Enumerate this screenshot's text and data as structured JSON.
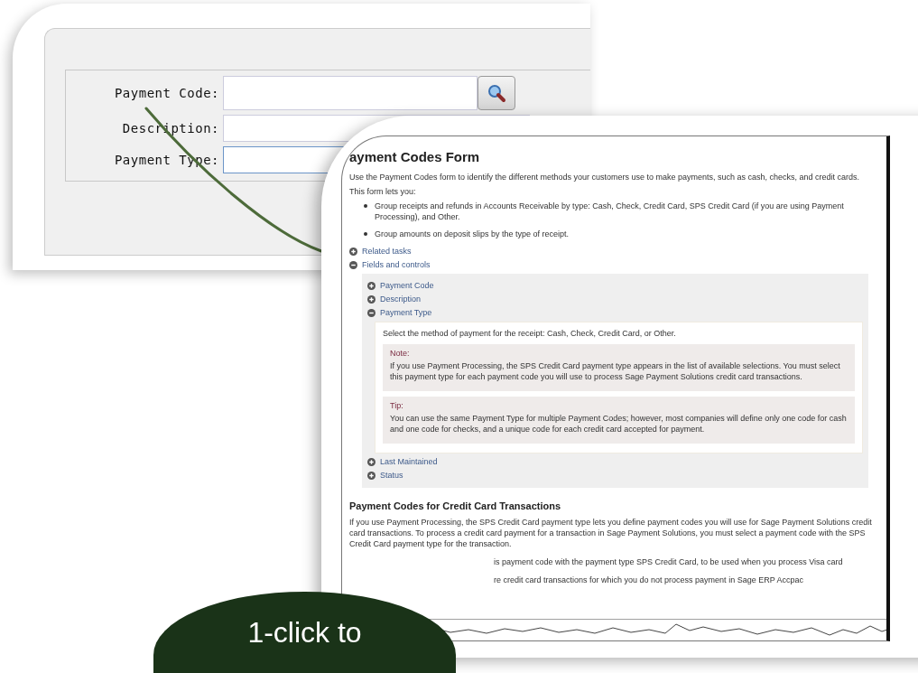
{
  "form_window": {
    "fields": [
      {
        "label": "Payment Code:",
        "lookup": true,
        "focused": false
      },
      {
        "label": "Description:",
        "lookup": false,
        "focused": false
      },
      {
        "label": "Payment Type:",
        "lookup": false,
        "focused": true
      }
    ]
  },
  "help_page": {
    "title": "ayment Codes Form",
    "intro": "Use the Payment Codes form to identify the different methods your customers use to make payments, such as cash, checks, and credit cards.",
    "lead": "This form lets you:",
    "bullets": [
      "Group receipts and refunds in Accounts Receivable by type: Cash, Check, Credit Card, SPS Credit Card (if you are using Payment Processing), and Other.",
      "Group amounts on deposit slips by the type of receipt."
    ],
    "sections": [
      {
        "label": "Related tasks",
        "expanded": false
      },
      {
        "label": "Fields and controls",
        "expanded": true,
        "children": [
          {
            "label": "Payment Code",
            "expanded": false
          },
          {
            "label": "Description",
            "expanded": false
          },
          {
            "label": "Payment Type",
            "expanded": true,
            "body": "Select the method of payment for the receipt: Cash, Check, Credit Card, or Other.",
            "notes": [
              {
                "heading": "Note:",
                "text": "If you use Payment Processing, the SPS Credit Card payment type appears in the list of available selections. You must select this payment type for each payment code you will use to process Sage Payment Solutions credit card transactions."
              },
              {
                "heading": "Tip:",
                "text": "You can use the same Payment Type for multiple Payment Codes; however, most companies will define only one code for cash and one code for checks, and a unique code for each credit card accepted for payment."
              }
            ]
          },
          {
            "label": "Last Maintained",
            "expanded": false
          },
          {
            "label": "Status",
            "expanded": false
          }
        ]
      }
    ],
    "subheading": "Payment Codes for Credit Card Transactions",
    "paragraph": "If you use Payment Processing, the SPS Credit Card payment type lets you define payment codes you will use for Sage Payment Solutions credit card transactions. To process a credit card payment for a transaction in Sage Payment Solutions, you must select a payment code with the SPS Credit Card payment type for the transaction.",
    "partial_lines": [
      "is payment code with the payment type SPS Credit Card, to be used when you process Visa card",
      "re credit card transactions for which you do not process payment in Sage ERP Accpac"
    ]
  },
  "callout": {
    "text": "1-click to"
  }
}
